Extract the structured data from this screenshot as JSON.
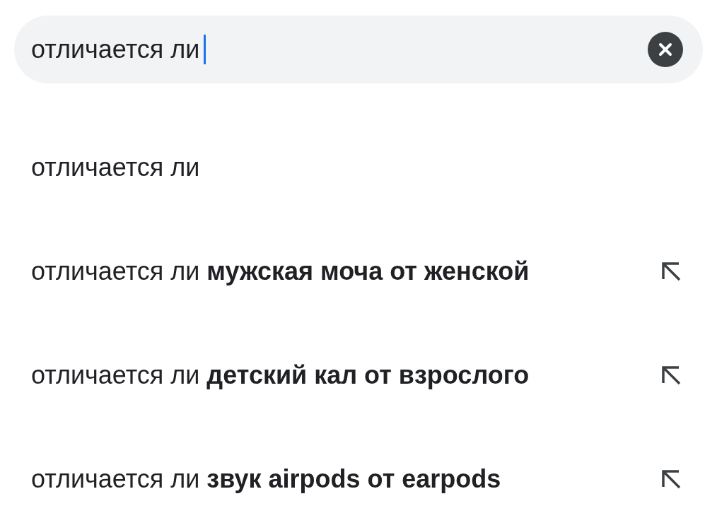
{
  "search": {
    "value": "отличается ли",
    "focused": true
  },
  "suggestions": [
    {
      "text": "отличается ли",
      "fill_arrow": false
    },
    {
      "text": "отличается ли **мужская моча от женской**",
      "fill_arrow": true
    },
    {
      "text": "отличается ли **детский кал от взрослого**",
      "fill_arrow": true
    },
    {
      "text": "отличается ли **звук airpods от earpods**",
      "fill_arrow": true
    }
  ]
}
